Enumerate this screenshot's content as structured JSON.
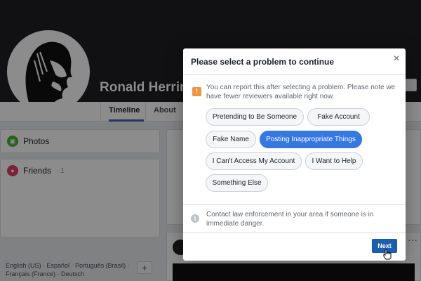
{
  "profile": {
    "name": "Ronald Herring",
    "tabs": [
      "Timeline",
      "About"
    ]
  },
  "sidebar": {
    "photos_label": "Photos",
    "friends_label": "Friends",
    "friends_count": "· 1"
  },
  "footer_links": {
    "languages_line1": "English (US) · Español · Português (Brasil) ·",
    "languages_line2": "Français (France) · Deutsch",
    "add_label": "+"
  },
  "dialog": {
    "title": "Please select a problem to continue",
    "close_label": "×",
    "warning_text": "You can report this after selecting a problem. Please note we have fewer reviewers available right now.",
    "options": [
      "Pretending to Be Someone",
      "Fake Account",
      "Fake Name",
      "Posting Inappropriate Things",
      "I Can't Access My Account",
      "I Want to Help",
      "Something Else"
    ],
    "selected_option": "Posting Inappropriate Things",
    "info_text": "Contact law enforcement in your area if someone is in immediate danger.",
    "next_label": "Next"
  },
  "colors": {
    "accent": "#3578e5",
    "warning": "#f7923b",
    "primary_button": "#1a5fb4"
  }
}
